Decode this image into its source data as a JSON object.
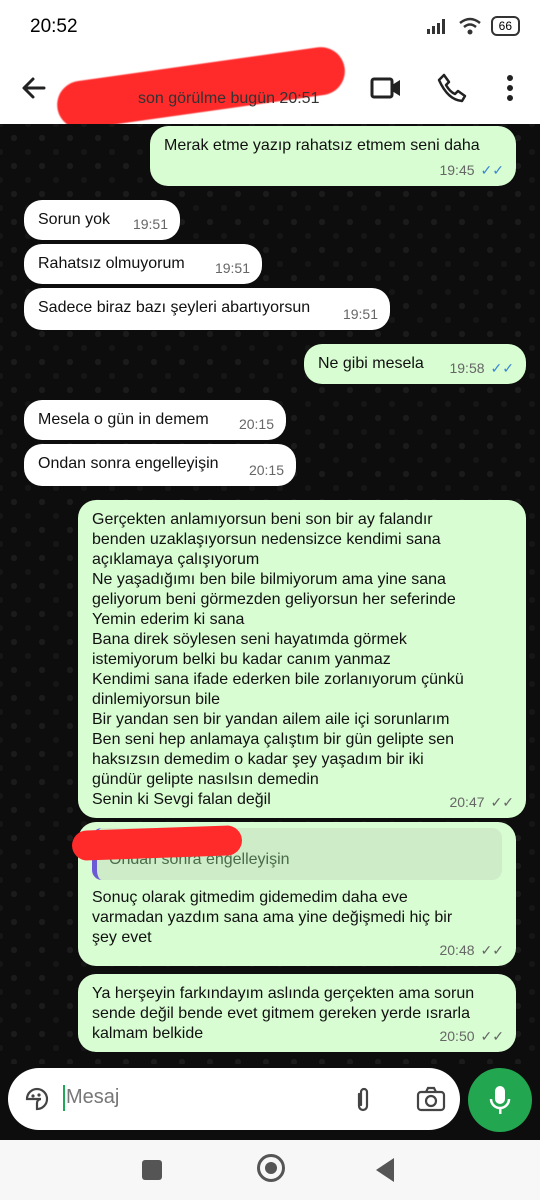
{
  "status": {
    "time": "20:52",
    "battery": "66"
  },
  "header": {
    "last_seen": "son görülme bugün 20:51"
  },
  "messages": [
    {
      "dir": "out",
      "text": "Merak etme yazıp rahatsız etmem seni  daha",
      "time": "19:45",
      "ticks": "✓✓",
      "read": true
    },
    {
      "dir": "in",
      "text": "Sorun yok",
      "time": "19:51"
    },
    {
      "dir": "in",
      "text": "Rahatsız olmuyorum",
      "time": "19:51"
    },
    {
      "dir": "in",
      "text": "Sadece biraz bazı şeyleri abartıyorsun",
      "time": "19:51"
    },
    {
      "dir": "out",
      "text": "Ne gibi mesela",
      "time": "19:58",
      "ticks": "✓✓",
      "read": true
    },
    {
      "dir": "in",
      "text": "Mesela o gün in demem",
      "time": "20:15"
    },
    {
      "dir": "in",
      "text": "Ondan sonra engelleyişin",
      "time": "20:15"
    },
    {
      "dir": "out",
      "text": "Gerçekten anlamıyorsun beni son bir ay falandır\nbenden uzaklaşıyorsun nedensizce kendimi sana\naçıklamaya çalışıyorum\nNe yaşadığımı ben bile bilmiyorum ama yine sana\ngeliyorum beni görmezden geliyorsun her seferinde\nYemin ederim ki sana\nBana direk söylesen seni hayatımda görmek\nistemiyorum belki bu kadar canım yanmaz\nKendimi sana ifade ederken bile zorlanıyorum çünkü\ndinlemiyorsun bile\nBir yandan sen bir yandan ailem aile içi sorunlarım\nBen seni hep anlamaya çalıştım bir gün gelipte sen\nhaksızsın demedim  o kadar şey yaşadım bir iki\ngündür gelipte nasılsın demedin\nSenin ki Sevgi falan değil",
      "time": "20:47",
      "ticks": "✓✓",
      "read": false
    },
    {
      "dir": "out",
      "quote": "Ondan sonra engelleyişin",
      "text": "Sonuç olarak gitmedim gidemedim daha eve\nvarmadan yazdım sana  ama yine  değişmedi hiç bir\nşey evet",
      "time": "20:48",
      "ticks": "✓✓",
      "read": false
    },
    {
      "dir": "out",
      "text": "Ya herşeyin farkındayım aslında gerçekten ama sorun\nsende değil bende evet  gitmem gereken yerde ısrarla\nkalmam   belkide",
      "time": "20:50",
      "ticks": "✓✓",
      "read": false
    }
  ],
  "composer": {
    "placeholder": "Mesaj"
  },
  "colors": {
    "outgoing": "#d8fdd2",
    "incoming": "#ffffff",
    "accent": "#22a650",
    "read_ticks": "#3a86d6"
  },
  "icons": [
    "back-arrow-icon",
    "video-call-icon",
    "phone-icon",
    "more-vert-icon",
    "sticker-icon",
    "attach-icon",
    "camera-icon",
    "mic-icon"
  ]
}
